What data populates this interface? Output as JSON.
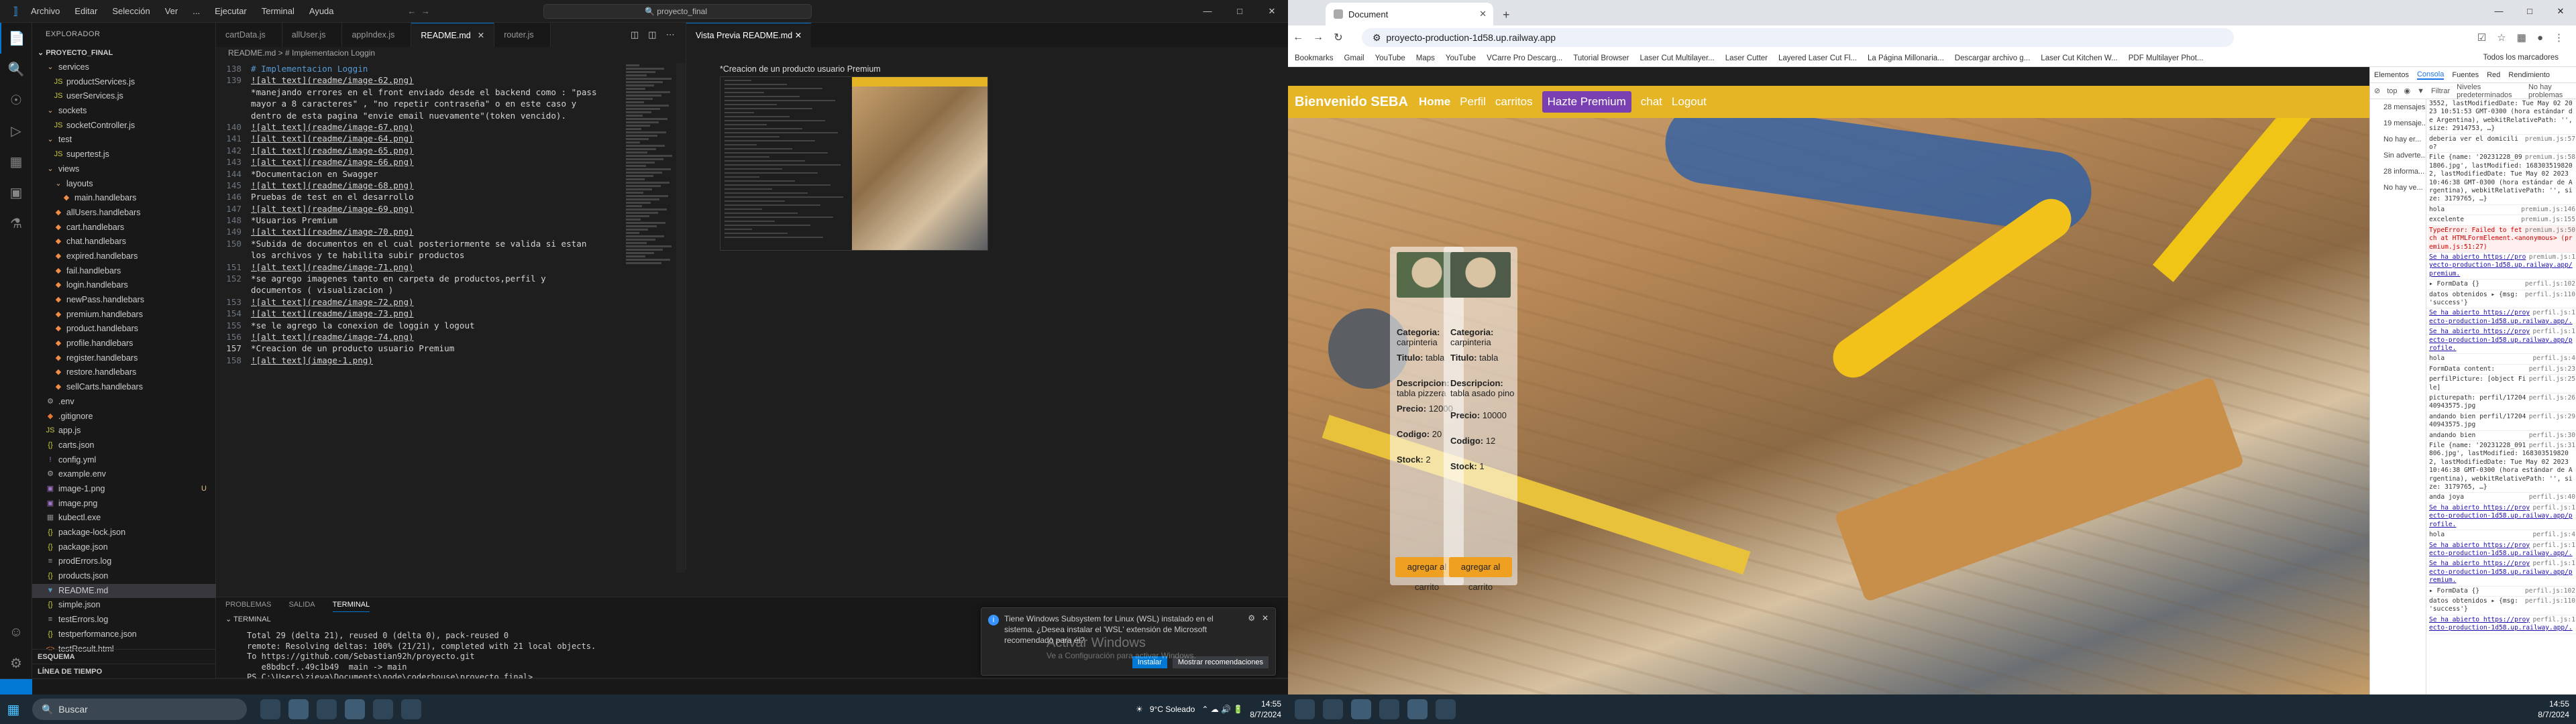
{
  "vscode": {
    "menu": [
      "Archivo",
      "Editar",
      "Selección",
      "Ver",
      "...",
      "Ejecutar",
      "Terminal",
      "Ayuda"
    ],
    "search": "proyecto_final",
    "explorer_title": "EXPLORADOR",
    "project": "PROYECTO_FINAL",
    "tree": [
      {
        "label": "services",
        "type": "folder",
        "depth": 1
      },
      {
        "label": "productServices.js",
        "type": "js",
        "depth": 2
      },
      {
        "label": "userServices.js",
        "type": "js",
        "depth": 2
      },
      {
        "label": "sockets",
        "type": "folder",
        "depth": 1
      },
      {
        "label": "socketController.js",
        "type": "js",
        "depth": 2
      },
      {
        "label": "test",
        "type": "folder",
        "depth": 1
      },
      {
        "label": "supertest.js",
        "type": "js",
        "depth": 2
      },
      {
        "label": "views",
        "type": "folder",
        "depth": 1
      },
      {
        "label": "layouts",
        "type": "folder",
        "depth": 2
      },
      {
        "label": "main.handlebars",
        "type": "hbs",
        "depth": 3
      },
      {
        "label": "allUsers.handlebars",
        "type": "hbs",
        "depth": 2
      },
      {
        "label": "cart.handlebars",
        "type": "hbs",
        "depth": 2
      },
      {
        "label": "chat.handlebars",
        "type": "hbs",
        "depth": 2
      },
      {
        "label": "expired.handlebars",
        "type": "hbs",
        "depth": 2
      },
      {
        "label": "fail.handlebars",
        "type": "hbs",
        "depth": 2
      },
      {
        "label": "login.handlebars",
        "type": "hbs",
        "depth": 2
      },
      {
        "label": "newPass.handlebars",
        "type": "hbs",
        "depth": 2
      },
      {
        "label": "premium.handlebars",
        "type": "hbs",
        "depth": 2
      },
      {
        "label": "product.handlebars",
        "type": "hbs",
        "depth": 2
      },
      {
        "label": "profile.handlebars",
        "type": "hbs",
        "depth": 2
      },
      {
        "label": "register.handlebars",
        "type": "hbs",
        "depth": 2
      },
      {
        "label": "restore.handlebars",
        "type": "hbs",
        "depth": 2
      },
      {
        "label": "sellCarts.handlebars",
        "type": "hbs",
        "depth": 2
      },
      {
        "label": ".env",
        "type": "env",
        "depth": 1
      },
      {
        "label": ".gitignore",
        "type": "git",
        "depth": 1
      },
      {
        "label": "app.js",
        "type": "js",
        "depth": 1
      },
      {
        "label": "carts.json",
        "type": "json",
        "depth": 1
      },
      {
        "label": "config.yml",
        "type": "yml",
        "depth": 1
      },
      {
        "label": "example.env",
        "type": "env",
        "depth": 1
      },
      {
        "label": "image-1.png",
        "type": "img",
        "depth": 1,
        "badge": "U"
      },
      {
        "label": "image.png",
        "type": "img",
        "depth": 1
      },
      {
        "label": "kubectl.exe",
        "type": "exe",
        "depth": 1
      },
      {
        "label": "package-lock.json",
        "type": "json",
        "depth": 1
      },
      {
        "label": "package.json",
        "type": "json",
        "depth": 1
      },
      {
        "label": "prodErrors.log",
        "type": "log",
        "depth": 1
      },
      {
        "label": "products.json",
        "type": "json",
        "depth": 1
      },
      {
        "label": "README.md",
        "type": "md",
        "depth": 1,
        "selected": true
      },
      {
        "label": "simple.json",
        "type": "json",
        "depth": 1
      },
      {
        "label": "testErrors.log",
        "type": "log",
        "depth": 1
      },
      {
        "label": "testperformance.json",
        "type": "json",
        "depth": 1
      },
      {
        "label": "testResult.html",
        "type": "html",
        "depth": 1
      }
    ],
    "bottom_sections": [
      "ESQUEMA",
      "LÍNEA DE TIEMPO"
    ],
    "tabs": [
      {
        "label": "cartData.js",
        "active": false
      },
      {
        "label": "allUser.js",
        "active": false
      },
      {
        "label": "appIndex.js",
        "active": false
      },
      {
        "label": "README.md",
        "active": true
      },
      {
        "label": "router.js",
        "active": false
      }
    ],
    "breadcrumb": "README.md  >  # Implementacion Loggin",
    "code_lines": [
      {
        "n": "138",
        "t": "# Implementacion Loggin",
        "k": "hd"
      },
      {
        "n": "139",
        "t": "![alt text](readme/image-62.png)",
        "k": "lnk"
      },
      {
        "n": "",
        "t": "*manejando errores en el front enviado desde el backend como : \"pass",
        "k": ""
      },
      {
        "n": "",
        "t": "mayor a 8 caracteres\" , \"no repetir contraseña\" o en este caso y",
        "k": ""
      },
      {
        "n": "",
        "t": "dentro de esta pagina \"envie email nuevamente\"(token vencido).",
        "k": ""
      },
      {
        "n": "140",
        "t": "![alt text](readme/image-67.png)",
        "k": "lnk"
      },
      {
        "n": "141",
        "t": "![alt text](readme/image-64.png)",
        "k": "lnk"
      },
      {
        "n": "142",
        "t": "![alt text](readme/image-65.png)",
        "k": "lnk"
      },
      {
        "n": "143",
        "t": "![alt text](readme/image-66.png)",
        "k": "lnk"
      },
      {
        "n": "144",
        "t": "*Documentacion en Swagger",
        "k": ""
      },
      {
        "n": "145",
        "t": "![alt text](readme/image-68.png)",
        "k": "lnk"
      },
      {
        "n": "146",
        "t": "Pruebas de test en el desarrollo",
        "k": ""
      },
      {
        "n": "147",
        "t": "![alt text](readme/image-69.png)",
        "k": "lnk"
      },
      {
        "n": "148",
        "t": "*Usuarios Premium",
        "k": ""
      },
      {
        "n": "149",
        "t": "![alt text](readme/image-70.png)",
        "k": "lnk"
      },
      {
        "n": "150",
        "t": "*Subida de documentos en el cual posteriormente se valida si estan",
        "k": ""
      },
      {
        "n": "",
        "t": "los archivos y te habilita subir productos",
        "k": ""
      },
      {
        "n": "151",
        "t": "![alt text](readme/image-71.png)",
        "k": "lnk"
      },
      {
        "n": "152",
        "t": "*se agrego imagenes tanto en carpeta de productos,perfil y",
        "k": ""
      },
      {
        "n": "",
        "t": "documentos ( visualizacion )",
        "k": ""
      },
      {
        "n": "153",
        "t": "![alt text](readme/image-72.png)",
        "k": "lnk"
      },
      {
        "n": "154",
        "t": "![alt text](readme/image-73.png)",
        "k": "lnk"
      },
      {
        "n": "155",
        "t": "*se le agrego la conexion de loggin y logout",
        "k": ""
      },
      {
        "n": "156",
        "t": "![alt text](readme/image-74.png)",
        "k": "lnk"
      },
      {
        "n": "157",
        "t": "*Creacion de un producto usuario Premium",
        "k": "",
        "cur": true
      },
      {
        "n": "158",
        "t": "![alt text](image-1.png)",
        "k": "lnk"
      }
    ],
    "preview_tab": "Vista Previa README.md",
    "preview_caption": "*Creacion de un producto usuario Premium",
    "panel_tabs": [
      "PROBLEMAS",
      "SALIDA",
      "TERMINAL"
    ],
    "terminal_label": "TERMINAL",
    "terminal_lines": [
      "Total 29 (delta 21), reused 0 (delta 0), pack-reused 0",
      "remote: Resolving deltas: 100% (21/21), completed with 21 local objects.",
      "To https://github.com/Sebastian92h/proyecto.git",
      "   e8bdbcf..49c1b49  main -> main",
      "PS C:\\Users\\zieva\\Documents\\node\\coderhouse\\proyecto_final> "
    ],
    "notification": {
      "text": "Tiene Windows Subsystem for Linux (WSL) instalado en el sistema. ¿Desea instalar el 'WSL' extensión de Microsoft recomendado para él?",
      "install": "Instalar",
      "recommend": "Mostrar recomendaciones"
    },
    "watermark_title": "Activar Windows",
    "watermark_sub": "Ve a Configuración para activar Windows."
  },
  "taskbar_left": {
    "search": "Buscar",
    "weather": "9°C  Soleado",
    "time": "14:55",
    "date": "8/7/2024"
  },
  "chrome": {
    "tab_title": "Document",
    "url": "proyecto-production-1d58.up.railway.app",
    "bookmarks": [
      "Bookmarks",
      "Gmail",
      "YouTube",
      "Maps",
      "YouTube",
      "VCarre Pro Descarg...",
      "Tutorial Browser",
      "Laser Cut Multilayer...",
      "Laser Cutter",
      "Layered Laser Cut Fl...",
      "La Página Millonaria...",
      "Descargar archivo g...",
      "Laser Cut Kitchen W...",
      "PDF Multilayer Phot..."
    ],
    "bookmarks_more": "Todos los marcadores"
  },
  "site": {
    "brand": "Bienvenido SEBA",
    "nav": [
      "Home",
      "Perfil",
      "carritos",
      "Hazte Premium",
      "chat",
      "Logout"
    ],
    "products": [
      {
        "categoria": "carpinteria",
        "titulo": "tabla",
        "descripcion": "tabla pizzera",
        "precio": "12000",
        "codigo": "20",
        "stock": "2",
        "button": "agregar al carrito"
      },
      {
        "categoria": "carpinteria",
        "titulo": "tabla",
        "descripcion": "tabla asado pino",
        "precio": "10000",
        "codigo": "12",
        "stock": "1",
        "button": "agregar al carrito"
      }
    ],
    "labels": {
      "categoria": "Categoria:",
      "titulo": "Titulo:",
      "descripcion": "Descripcion:",
      "precio": "Precio:",
      "codigo": "Codigo:",
      "stock": "Stock:"
    }
  },
  "devtools": {
    "tabs": [
      "Elementos",
      "Consola",
      "Fuentes",
      "Red",
      "Rendimiento"
    ],
    "active_tab": "Consola",
    "filter_placeholder": "Filtrar",
    "levels": "Niveles predeterminados",
    "issues": "No hay problemas",
    "context": "top",
    "sidebar": [
      "28 mensajes",
      "19 mensaje...",
      "No hay er...",
      "Sin adverte...",
      "28 informa...",
      "No hay ve..."
    ],
    "console": [
      {
        "t": "3552, lastModifiedDate: Tue May 02 2023 10:51:53 GMT-0300 (hora estándar de Argentina), webkitRelativePath: '', size: 2914753, …}",
        "s": ""
      },
      {
        "t": "deberia ver el domicilio?",
        "s": "premium.js:57"
      },
      {
        "t": "File {name: '20231228_091806.jpg', lastModified: 1683035198202, lastModifiedDate: Tue May 02 2023 10:46:38 GMT-0300 (hora estándar de Argentina), webkitRelativePath: '', size: 3179765, …}",
        "s": "premium.js:58"
      },
      {
        "t": "hola",
        "s": "premium.js:146"
      },
      {
        "t": "excelente",
        "s": "premium.js:155"
      },
      {
        "t": "TypeError: Failed to fetch at HTMLFormElement.<anonymous> (premium.js:51:27)",
        "s": "premium.js:50",
        "err": true
      },
      {
        "t": "Se ha abierto https://proyecto-production-1d58.up.railway.app/premium.",
        "s": "premium.js:1"
      },
      {
        "t": "▸ FormData {}",
        "s": "perfil.js:102"
      },
      {
        "t": "datos obtenidos ▸ {msg: 'success'}",
        "s": "perfil.js:110"
      },
      {
        "t": "Se ha abierto https://proyecto-production-1d58.up.railway.app/.",
        "s": "perfil.js:1"
      },
      {
        "t": "Se ha abierto https://proyecto-production-1d58.up.railway.app/profile.",
        "s": "perfil.js:1"
      },
      {
        "t": "hola",
        "s": "perfil.js:4"
      },
      {
        "t": "FormData content:",
        "s": "perfil.js:23"
      },
      {
        "t": "perfilPicture: [object File]",
        "s": "perfil.js:25"
      },
      {
        "t": "picturepath: perfil/1720440943575.jpg",
        "s": "perfil.js:26"
      },
      {
        "t": "andando bien perfil/1720440943575.jpg",
        "s": "perfil.js:29"
      },
      {
        "t": "andando bien",
        "s": "perfil.js:30"
      },
      {
        "t": "File {name: '20231228_091806.jpg', lastModified: 1683035198202, lastModifiedDate: Tue May 02 2023 10:46:38 GMT-0300 (hora estándar de Argentina), webkitRelativePath: '', size: 3179765, …}",
        "s": "perfil.js:31"
      },
      {
        "t": "anda joya",
        "s": "perfil.js:40"
      },
      {
        "t": "Se ha abierto https://proyecto-production-1d58.up.railway.app/profile.",
        "s": "perfil.js:1"
      },
      {
        "t": "hola",
        "s": "perfil.js:4"
      },
      {
        "t": "Se ha abierto https://proyecto-production-1d58.up.railway.app/.",
        "s": "perfil.js:1"
      },
      {
        "t": "Se ha abierto https://proyecto-production-1d58.up.railway.app/premium.",
        "s": "perfil.js:1"
      },
      {
        "t": "▸ FormData {}",
        "s": "perfil.js:102"
      },
      {
        "t": "datos obtenidos ▸ {msg: 'success'}",
        "s": "perfil.js:110"
      },
      {
        "t": "Se ha abierto https://proyecto-production-1d58.up.railway.app/.",
        "s": "perfil.js:1"
      }
    ]
  },
  "taskbar_right": {
    "time": "14:55",
    "date": "8/7/2024"
  }
}
